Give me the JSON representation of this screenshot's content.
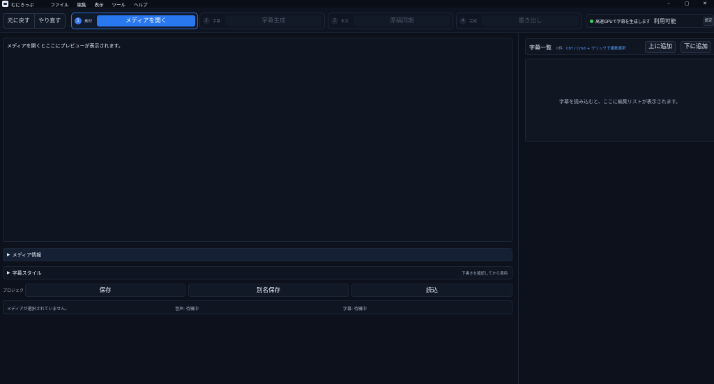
{
  "app": {
    "title": "むにろっぷ",
    "menu": [
      "ファイル",
      "編集",
      "表示",
      "ツール",
      "ヘルプ"
    ],
    "window_controls": [
      "–",
      "▢",
      "✕"
    ]
  },
  "toolbar": {
    "undo_label": "元に戻す",
    "redo_label": "やり直す",
    "steps": [
      {
        "num": "1",
        "tag": "素材",
        "label": "メディアを開く",
        "active": true
      },
      {
        "num": "2",
        "tag": "字幕",
        "label": "字幕生成",
        "active": false
      },
      {
        "num": "3",
        "tag": "本文",
        "label": "原稿同期",
        "active": false
      },
      {
        "num": "4",
        "tag": "完成",
        "label": "書き出し",
        "active": false
      }
    ],
    "gpu": {
      "label": "高速GPUで字幕を生成します",
      "status": "利用可能",
      "setting_label": "設定",
      "status_color": "#2fd35a"
    }
  },
  "preview": {
    "placeholder": "メディアを開くとここにプレビューが表示されます。"
  },
  "sections": {
    "media_info": "メディア情報",
    "subtitle_style": "字幕スタイル",
    "subtitle_style_hint": "下書きを確認してから適用"
  },
  "project": {
    "label": "プロジェクト",
    "save": "保存",
    "save_as": "別名保存",
    "load": "読込"
  },
  "status": {
    "media": "メディアが選択されていません。",
    "audio": "音声: 待機中",
    "subtitle": "字幕: 待機中"
  },
  "subtitle_panel": {
    "title": "字幕一覧",
    "count": "0件",
    "hint": "Ctrl / Cmd + クリックで複数選択",
    "add_above": "上に追加",
    "add_below": "下に追加",
    "empty": "字幕を読み込むと、ここに編集リストが表示されます。"
  },
  "colors": {
    "accent": "#2a78f0",
    "background": "#0c111b"
  }
}
